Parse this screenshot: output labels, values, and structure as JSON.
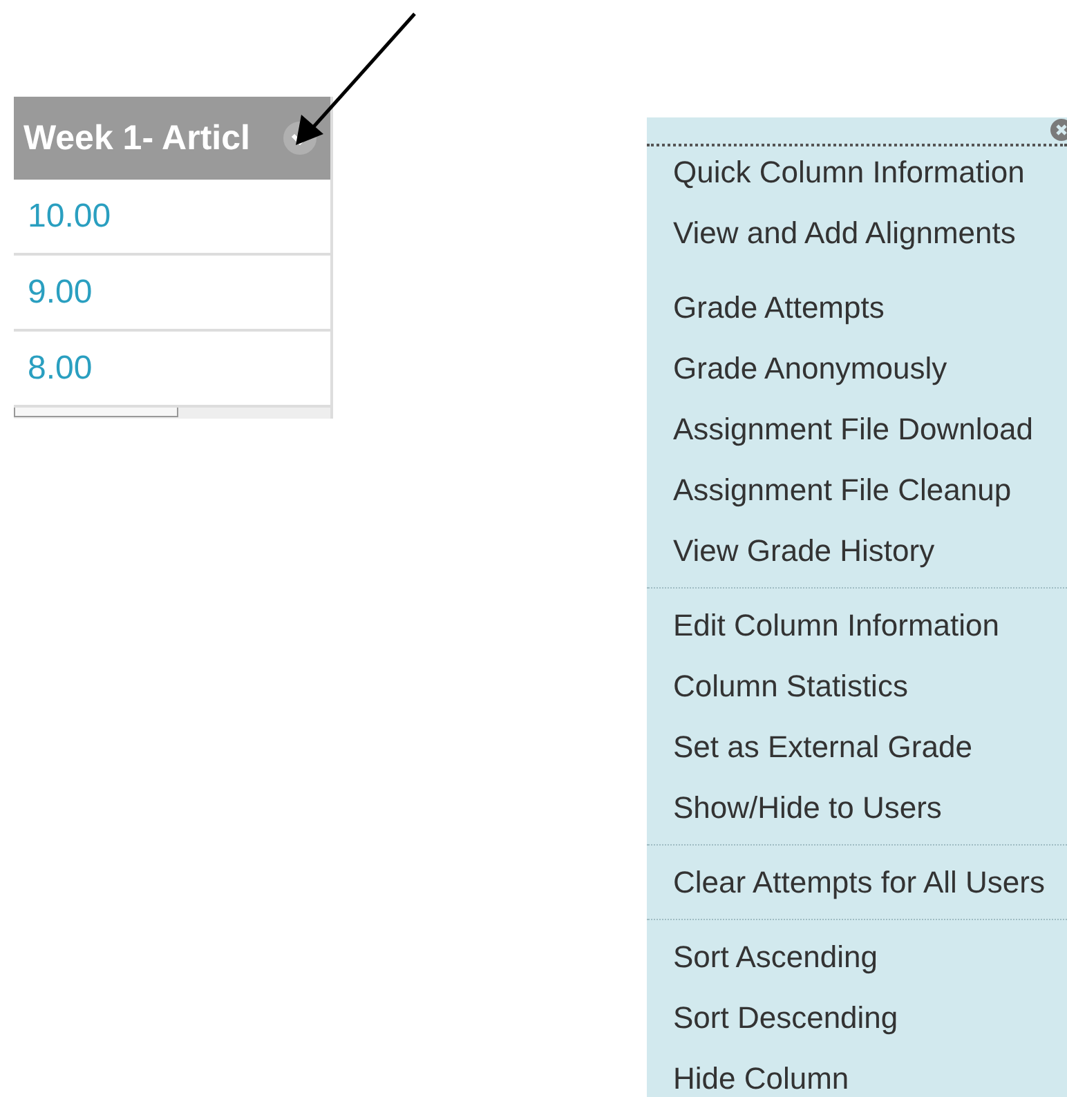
{
  "grade_column": {
    "header": "Week 1- Articl",
    "cells": [
      "10.00",
      "9.00",
      "8.00"
    ]
  },
  "menu": {
    "groups": [
      {
        "divider": false,
        "items": [
          "Quick Column Information",
          "View and Add Alignments"
        ]
      },
      {
        "divider": true,
        "items": [
          "Grade Attempts",
          "Grade Anonymously",
          "Assignment File Download",
          "Assignment File Cleanup",
          "View Grade History"
        ]
      },
      {
        "divider": true,
        "items": [
          "Edit Column Information",
          "Column Statistics",
          "Set as External Grade",
          "Show/Hide to Users"
        ]
      },
      {
        "divider": true,
        "items": [
          "Clear Attempts for All Users"
        ]
      },
      {
        "divider": false,
        "items": [
          "Sort Ascending",
          "Sort Descending",
          "Hide Column"
        ]
      }
    ]
  }
}
